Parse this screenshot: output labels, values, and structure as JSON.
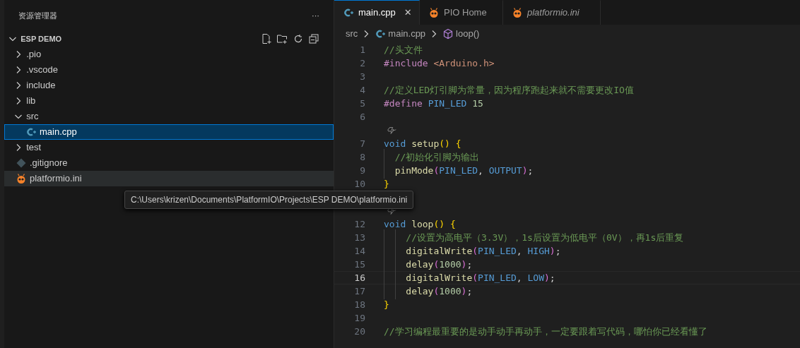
{
  "sidebar": {
    "title": "资源管理器",
    "more": "···",
    "project": {
      "name": "ESP DEMO",
      "expanded": true
    },
    "items": [
      {
        "label": ".pio",
        "kind": "folder",
        "expanded": false,
        "selected": false,
        "hovered": false
      },
      {
        "label": ".vscode",
        "kind": "folder",
        "expanded": false,
        "selected": false,
        "hovered": false
      },
      {
        "label": "include",
        "kind": "folder",
        "expanded": false,
        "selected": false,
        "hovered": false
      },
      {
        "label": "lib",
        "kind": "folder",
        "expanded": false,
        "selected": false,
        "hovered": false
      },
      {
        "label": "src",
        "kind": "folder",
        "expanded": true,
        "selected": false,
        "hovered": false,
        "children": [
          {
            "label": "main.cpp",
            "kind": "cpp",
            "selected": true,
            "hovered": false
          }
        ]
      },
      {
        "label": "test",
        "kind": "folder",
        "expanded": false,
        "selected": false,
        "hovered": false
      },
      {
        "label": ".gitignore",
        "kind": "git",
        "selected": false,
        "hovered": false
      },
      {
        "label": "platformio.ini",
        "kind": "pio",
        "selected": false,
        "hovered": true
      }
    ],
    "tooltip": "C:\\Users\\krizen\\Documents\\PlatformIO\\Projects\\ESP DEMO\\platformio.ini"
  },
  "tabs": [
    {
      "label": "main.cpp",
      "kind": "cpp",
      "selected": true,
      "preview": false,
      "close": "✕"
    },
    {
      "label": "PIO Home",
      "kind": "pio",
      "selected": false,
      "preview": false
    },
    {
      "label": "platformio.ini",
      "kind": "pio",
      "selected": false,
      "preview": true
    }
  ],
  "breadcrumb": [
    {
      "label": "src",
      "kind": "folder"
    },
    {
      "label": "main.cpp",
      "kind": "cpp"
    },
    {
      "label": "loop()",
      "kind": "method"
    }
  ],
  "lines": [
    {
      "number": "1",
      "current": false,
      "tokens": [
        {
          "kind": "c",
          "text": "//头文件"
        }
      ]
    },
    {
      "number": "2",
      "current": false,
      "tokens": [
        {
          "kind": "p",
          "text": "#include "
        },
        {
          "kind": "s",
          "text": "<Arduino.h>"
        }
      ]
    },
    {
      "number": "3",
      "current": false
    },
    {
      "number": "4",
      "current": false,
      "tokens": [
        {
          "kind": "c",
          "text": "//定义LED灯引脚为常量，因为程序跑起来就不需要更改IO值"
        }
      ]
    },
    {
      "number": "5",
      "current": false,
      "tokens": [
        {
          "kind": "p",
          "text": "#define "
        },
        {
          "kind": "m",
          "text": "PIN_LED "
        },
        {
          "kind": "n",
          "text": "15"
        }
      ]
    },
    {
      "number": "6",
      "current": false
    },
    {
      "kind": "codelens"
    },
    {
      "number": "7",
      "current": false,
      "tokens": [
        {
          "kind": "k",
          "text": "void "
        },
        {
          "kind": "f",
          "text": "setup"
        },
        {
          "kind": "b1",
          "text": "() {"
        }
      ]
    },
    {
      "number": "8",
      "current": false,
      "tokens": [
        {
          "kind": "c",
          "text": "  //初始化引脚为输出"
        }
      ]
    },
    {
      "number": "9",
      "current": false,
      "tokens": [
        {
          "kind": "f",
          "text": "  pinMode"
        },
        {
          "kind": "b2",
          "text": "("
        },
        {
          "kind": "m",
          "text": "PIN_LED"
        },
        {
          "kind": "t",
          "text": ", "
        },
        {
          "kind": "m",
          "text": "OUTPUT"
        },
        {
          "kind": "b2",
          "text": ")"
        },
        {
          "kind": "t",
          "text": ";"
        }
      ]
    },
    {
      "number": "10",
      "current": false,
      "tokens": [
        {
          "kind": "b1",
          "text": "}"
        }
      ]
    },
    {
      "kind": "codelens"
    },
    {
      "number": "12",
      "current": false,
      "tokens": [
        {
          "kind": "k",
          "text": "void "
        },
        {
          "kind": "f",
          "text": "loop"
        },
        {
          "kind": "b1",
          "text": "() {"
        }
      ]
    },
    {
      "number": "13",
      "current": false,
      "tokens": [
        {
          "kind": "c",
          "text": "    //设置为高电平（3.3V），1s后设置为低电平（0V），再1s后重复"
        }
      ]
    },
    {
      "number": "14",
      "current": false,
      "tokens": [
        {
          "kind": "f",
          "text": "    digitalWrite"
        },
        {
          "kind": "b2",
          "text": "("
        },
        {
          "kind": "m",
          "text": "PIN_LED"
        },
        {
          "kind": "t",
          "text": ", "
        },
        {
          "kind": "m",
          "text": "HIGH"
        },
        {
          "kind": "b2",
          "text": ")"
        },
        {
          "kind": "t",
          "text": ";"
        }
      ]
    },
    {
      "number": "15",
      "current": false,
      "tokens": [
        {
          "kind": "f",
          "text": "    delay"
        },
        {
          "kind": "b2",
          "text": "("
        },
        {
          "kind": "n",
          "text": "1000"
        },
        {
          "kind": "b2",
          "text": ")"
        },
        {
          "kind": "t",
          "text": ";"
        }
      ]
    },
    {
      "number": "16",
      "current": true,
      "tokens": [
        {
          "kind": "f",
          "text": "    digitalWrite"
        },
        {
          "kind": "b2",
          "text": "("
        },
        {
          "kind": "m",
          "text": "PIN_LED"
        },
        {
          "kind": "t",
          "text": ", "
        },
        {
          "kind": "m",
          "text": "LOW"
        },
        {
          "kind": "b2",
          "text": ")"
        },
        {
          "kind": "t",
          "text": ";"
        }
      ]
    },
    {
      "number": "17",
      "current": false,
      "tokens": [
        {
          "kind": "f",
          "text": "    delay"
        },
        {
          "kind": "b2",
          "text": "("
        },
        {
          "kind": "n",
          "text": "1000"
        },
        {
          "kind": "b2",
          "text": ")"
        },
        {
          "kind": "t",
          "text": ";"
        }
      ]
    },
    {
      "number": "18",
      "current": false,
      "tokens": [
        {
          "kind": "b1",
          "text": "}"
        }
      ]
    },
    {
      "number": "19",
      "current": false
    },
    {
      "number": "20",
      "current": false,
      "tokens": [
        {
          "kind": "c",
          "text": "//学习编程最重要的是动手动手再动手，一定要跟着写代码，哪怕你已经看懂了"
        }
      ]
    }
  ]
}
